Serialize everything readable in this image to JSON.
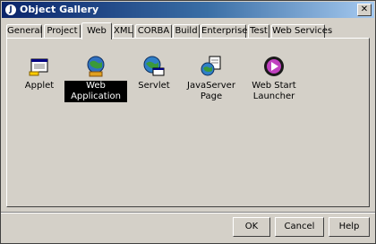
{
  "window": {
    "title": "Object Gallery"
  },
  "tabs": [
    "General",
    "Project",
    "Web",
    "XML",
    "CORBA",
    "Build",
    "Enterprise",
    "Test",
    "Web Services"
  ],
  "active_tab": "Web",
  "items": [
    {
      "label": "Applet",
      "icon": "applet-icon"
    },
    {
      "label": "Web Application",
      "icon": "web-application-icon",
      "selected": true
    },
    {
      "label": "Servlet",
      "icon": "servlet-icon"
    },
    {
      "label": "JavaServer Page",
      "icon": "jsp-icon"
    },
    {
      "label_line1": "Web Start",
      "label_line2": "Launcher",
      "icon": "web-start-launcher-icon"
    }
  ],
  "buttons": {
    "ok": "OK",
    "cancel": "Cancel",
    "help": "Help"
  },
  "colors": {
    "titlebar_start": "#0a246a",
    "titlebar_end": "#a6caf0",
    "face": "#d4d0c8",
    "selection": "#000000"
  }
}
